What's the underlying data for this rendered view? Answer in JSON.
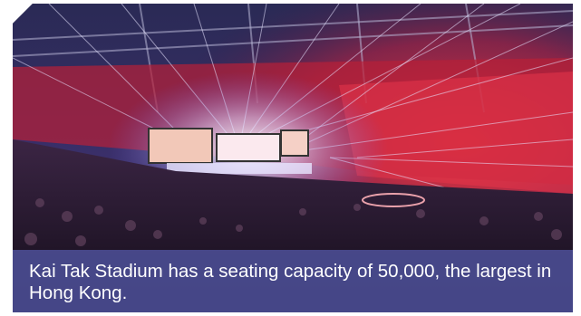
{
  "photo": {
    "subject": "stadium-concert-photo"
  },
  "caption": {
    "text": "Kai Tak Stadium has a seating capacity of 50,000, the largest in Hong Kong."
  },
  "colors": {
    "caption_background": "#4c4f96",
    "caption_text": "#ffffff"
  }
}
